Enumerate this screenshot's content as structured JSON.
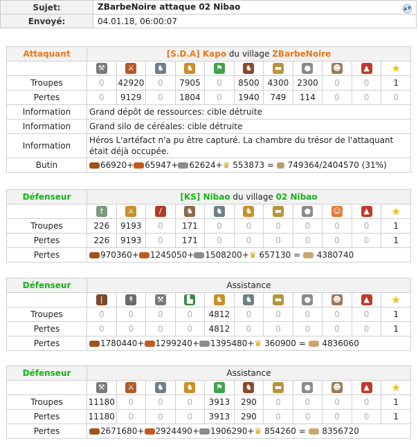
{
  "header": {
    "subject_label": "Sujet:",
    "subject": "ZBarbeNoire attaque 02 Nibao",
    "sent_label": "Envoyé:",
    "sent": "04.01.18, 06:00:07"
  },
  "attacker": {
    "role": "Attaquant",
    "player": "[S.D.A] Kapo",
    "village_text": " du village ",
    "village": "ZBarbeNoire",
    "unit_icons": [
      "mace-icon",
      "sword-icon",
      "horse-icon",
      "knight-icon",
      "pathfinder-icon",
      "cavalry-icon",
      "ram-icon",
      "catapult-icon",
      "chief-icon",
      "settler-icon",
      "hero-star-icon"
    ],
    "troops_label": "Troupes",
    "troops": [
      "0",
      "42920",
      "0",
      "7905",
      "0",
      "8500",
      "4300",
      "2300",
      "0",
      "0",
      "1"
    ],
    "losses_label": "Pertes",
    "losses": [
      "0",
      "9129",
      "0",
      "1804",
      "0",
      "1940",
      "749",
      "114",
      "0",
      "0",
      "0"
    ],
    "info_label": "Information",
    "info1": "Grand dépôt de ressources: cible détruite",
    "info2": "Grand silo de céréales: cible détruite",
    "info3": "Héros L'artéfact n'a pu être capturé. La chambre du trésor de l'attaquant était déjà occupée.",
    "bounty_label": "Butin",
    "bounty": {
      "wood": "66920+",
      "clay": "65947+",
      "iron": "62624+",
      "crop": " 553873",
      "total": " = ",
      "amount": " 749364/2404570 (31%)"
    }
  },
  "defender1": {
    "role": "Défenseur",
    "player": "[KS] Nibao",
    "village_text": " du village ",
    "village": "02 Nibao",
    "unit_icons": [
      "legionnaire-icon",
      "praetorian-icon",
      "imperian-icon",
      "scout-icon",
      "horse-icon",
      "knight-icon",
      "ram-icon",
      "catapult-icon",
      "senator-icon",
      "settler-icon",
      "hero-star-icon"
    ],
    "troops_label": "Troupes",
    "troops": [
      "226",
      "9193",
      "0",
      "171",
      "0",
      "0",
      "0",
      "0",
      "0",
      "0",
      "1"
    ],
    "losses_label": "Pertes",
    "losses": [
      "226",
      "9193",
      "0",
      "171",
      "0",
      "0",
      "0",
      "0",
      "0",
      "0",
      "1"
    ],
    "resloss_label": "Pertes",
    "resloss": {
      "wood": "970360+",
      "clay": "1245050+",
      "iron": "1508200+",
      "crop": " 657130",
      "eq": " = ",
      "total": " 4380740"
    }
  },
  "defender2": {
    "role": "Défenseur",
    "title": "Assistance",
    "unit_icons": [
      "club-icon",
      "spear-icon",
      "axe-icon",
      "boot-icon",
      "paladin-icon",
      "horse-icon",
      "ram-icon",
      "catapult-icon",
      "chief-icon",
      "settler-icon",
      "hero-star-icon"
    ],
    "troops_label": "Troupes",
    "troops": [
      "0",
      "0",
      "0",
      "0",
      "4812",
      "0",
      "0",
      "0",
      "0",
      "0",
      "1"
    ],
    "losses_label": "Pertes",
    "losses": [
      "0",
      "0",
      "0",
      "0",
      "4812",
      "0",
      "0",
      "0",
      "0",
      "0",
      "1"
    ],
    "resloss_label": "Pertes",
    "resloss": {
      "wood": "1780440+",
      "clay": "1299240+",
      "iron": "1395480+",
      "crop": " 360900",
      "eq": " = ",
      "total": " 4836060"
    }
  },
  "defender3": {
    "role": "Défenseur",
    "title": "Assistance",
    "unit_icons": [
      "mace-icon",
      "sword-icon",
      "horse-icon",
      "knight-icon",
      "pathfinder-icon",
      "cavalry-icon",
      "ram-icon",
      "catapult-icon",
      "chief-icon",
      "settler-icon",
      "hero-star-icon"
    ],
    "troops_label": "Troupes",
    "troops": [
      "11180",
      "0",
      "0",
      "0",
      "3913",
      "290",
      "0",
      "0",
      "0",
      "0",
      "1"
    ],
    "losses_label": "Pertes",
    "losses": [
      "11180",
      "0",
      "0",
      "0",
      "3913",
      "290",
      "0",
      "0",
      "0",
      "0",
      "1"
    ],
    "resloss_label": "Pertes",
    "resloss": {
      "wood": "2671680+",
      "clay": "2924490+",
      "iron": "1906290+",
      "crop": " 854260",
      "eq": " = ",
      "total": " 8356720"
    }
  },
  "colors": {
    "attacker": "#e8771a",
    "defender": "#17b317",
    "header_bg": "#f2f2f2",
    "border": "#cfcfcf",
    "zero": "#b0b0b0"
  }
}
